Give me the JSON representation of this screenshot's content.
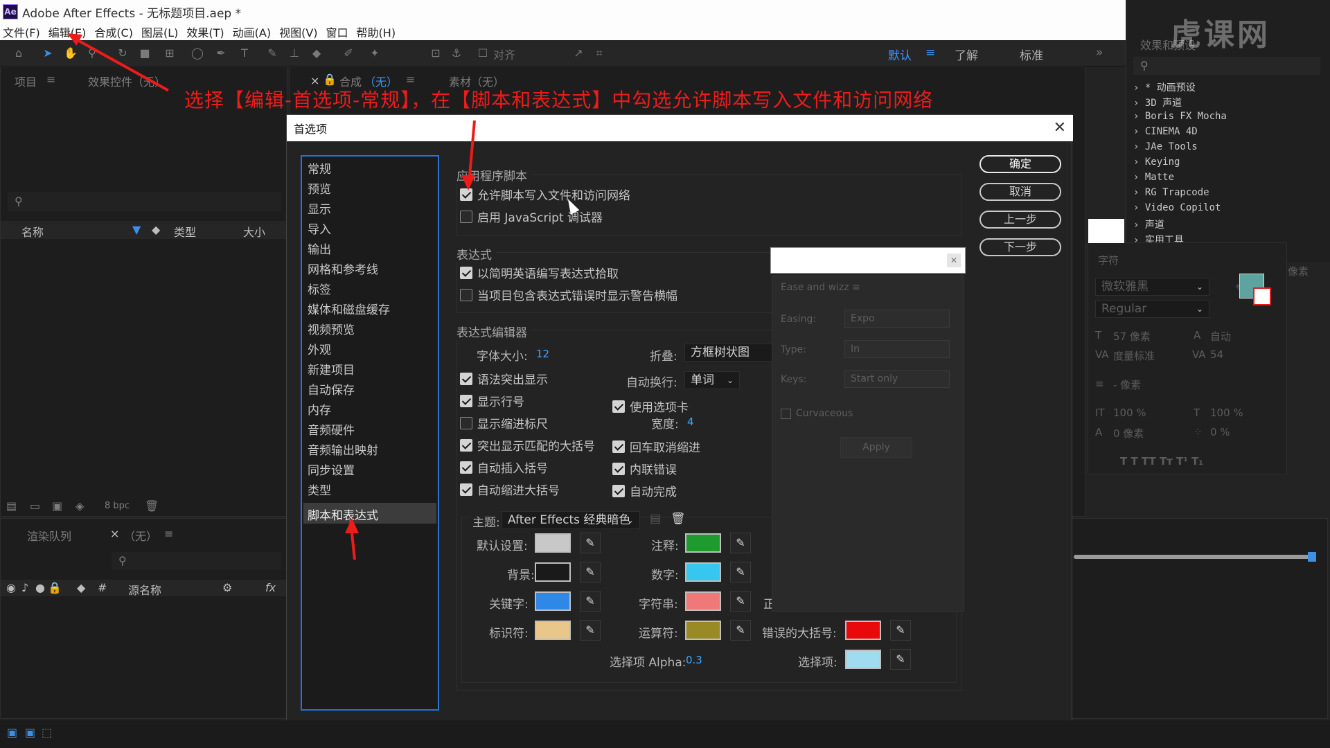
{
  "window": {
    "title": "Adobe After Effects - 无标题项目.aep *",
    "logo_text": "Ae"
  },
  "menu": [
    "文件(F)",
    "编辑(E)",
    "合成(C)",
    "图层(L)",
    "效果(T)",
    "动画(A)",
    "视图(V)",
    "窗口",
    "帮助(H)"
  ],
  "toolbar": {
    "align_label": "对齐",
    "workspaces": [
      "默认",
      "了解",
      "标准"
    ]
  },
  "project_panel": {
    "tab_project": "项目",
    "tab_effects_controls": "效果控件（无）",
    "columns": [
      "名称",
      "类型",
      "大小"
    ],
    "bpc": "8 bpc"
  },
  "comp_panel": {
    "tab_comp": "合成",
    "comp_name": "（无）",
    "tab_footage": "素材（无）"
  },
  "render_panel": {
    "tab_render": "渲染队列",
    "tab_timeline": "（无）",
    "source_name": "源名称"
  },
  "effects_panel": {
    "title": "效果和预设",
    "items": [
      "* 动画预设",
      "3D 声道",
      "Boris FX Mocha",
      "CINEMA 4D",
      "JAe Tools",
      "Keying",
      "Matte",
      "RG Trapcode",
      "Video Copilot",
      "声道",
      "实用工具"
    ]
  },
  "watermark": "虎课网",
  "annotation": "选择【编辑-首选项-常规】，在【脚本和表达式】中勾选允许脚本写入文件和访问网络",
  "dialog": {
    "title": "首选项",
    "categories": [
      "常规",
      "预览",
      "显示",
      "导入",
      "输出",
      "网格和参考线",
      "标签",
      "媒体和磁盘缓存",
      "视频预览",
      "外观",
      "新建项目",
      "自动保存",
      "内存",
      "音频硬件",
      "音频输出映射",
      "同步设置",
      "类型",
      "脚本和表达式"
    ],
    "selected_category": "脚本和表达式",
    "buttons": {
      "ok": "确定",
      "cancel": "取消",
      "prev": "上一步",
      "next": "下一步"
    },
    "app_scripts": {
      "label": "应用程序脚本",
      "allow_write": "允许脚本写入文件和访问网络",
      "enable_js_debugger": "启用 JavaScript 调试器"
    },
    "expressions": {
      "label": "表达式",
      "plain_english": "以简明英语编写表达式拾取",
      "show_warning": "当项目包含表达式错误时显示警告横幅"
    },
    "editor": {
      "label": "表达式编辑器",
      "font_size_label": "字体大小:",
      "font_size_value": "12",
      "fold_label": "折叠:",
      "fold_value": "方框树状图",
      "wrap_label": "自动换行:",
      "wrap_value": "单词",
      "syntax_highlight": "语法突出显示",
      "show_line_numbers": "显示行号",
      "use_tabs": "使用选项卡",
      "tab_width_label": "宽度:",
      "tab_width_value": "4",
      "show_indent_guides": "显示缩进标尺",
      "highlight_brackets": "突出显示匹配的大括号",
      "enter_unindent": "回车取消缩进",
      "auto_close_brackets": "自动插入括号",
      "inline_errors": "内联错误",
      "auto_indent_braces": "自动缩进大括号",
      "auto_complete": "自动完成",
      "theme_label": "主题:",
      "theme_value": "After Effects 经典暗色",
      "colors": {
        "default_label": "默认设置:",
        "default_color": "#c8c8c8",
        "background_label": "背景:",
        "background_color": "#1a1a1a",
        "keyword_label": "关键字:",
        "keyword_color": "#2f87e6",
        "identifier_label": "标识符:",
        "identifier_color": "#e9c78b",
        "comment_label": "注释:",
        "comment_color": "#1e9a2e",
        "number_label": "数字:",
        "number_color": "#36c6f0",
        "string_label": "字符串:",
        "string_color": "#f07878",
        "operator_label": "运算符:",
        "operator_color": "#9a8a25",
        "error_bracket_label": "错误的大括号:",
        "error_bracket_color": "#e80a0a",
        "selection_label": "选择项:",
        "selection_color": "#9fdcef",
        "selection_alpha_label": "选择项 Alpha:",
        "selection_alpha_value": "0.3",
        "partial_label": "正"
      }
    }
  },
  "ease_wizz": {
    "title": "Ease and wizz",
    "easing_label": "Easing:",
    "easing_value": "Expo",
    "type_label": "Type:",
    "type_value": "In",
    "keys_label": "Keys:",
    "keys_value": "Start only",
    "curvaceous": "Curvaceous",
    "apply": "Apply"
  },
  "character_panel": {
    "title": "字符",
    "font": "微软雅黑",
    "style": "Regular",
    "size": "57 像素",
    "leading": "自动",
    "kerning": "度量标准",
    "tracking": "54",
    "stroke": "- 像素",
    "vscale": "100 %",
    "hscale": "100 %",
    "baseline": "0 像素",
    "tsume": "0 %",
    "extra_label": "像素"
  }
}
